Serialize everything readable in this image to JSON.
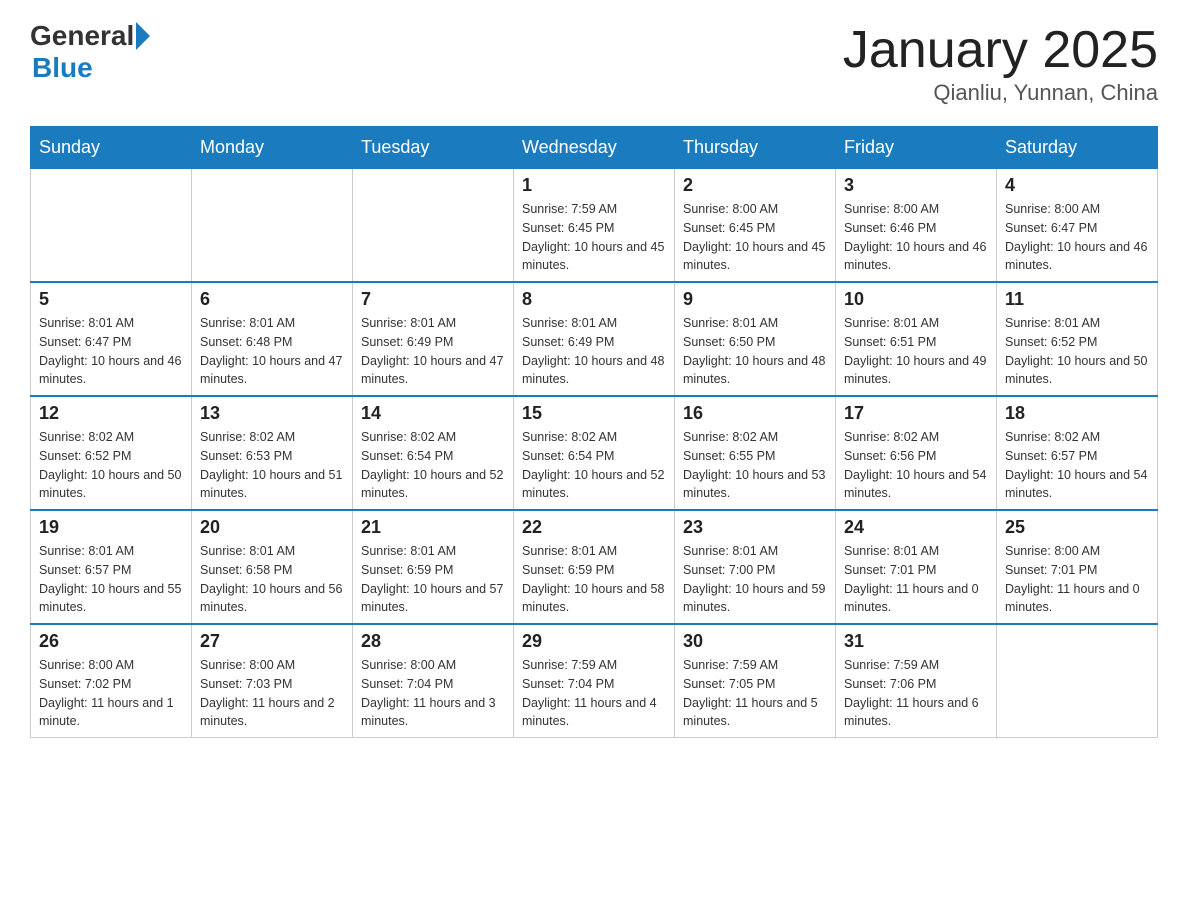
{
  "logo": {
    "text_general": "General",
    "text_blue": "Blue"
  },
  "title": "January 2025",
  "subtitle": "Qianliu, Yunnan, China",
  "days_of_week": [
    "Sunday",
    "Monday",
    "Tuesday",
    "Wednesday",
    "Thursday",
    "Friday",
    "Saturday"
  ],
  "weeks": [
    [
      {
        "day": "",
        "info": ""
      },
      {
        "day": "",
        "info": ""
      },
      {
        "day": "",
        "info": ""
      },
      {
        "day": "1",
        "info": "Sunrise: 7:59 AM\nSunset: 6:45 PM\nDaylight: 10 hours and 45 minutes."
      },
      {
        "day": "2",
        "info": "Sunrise: 8:00 AM\nSunset: 6:45 PM\nDaylight: 10 hours and 45 minutes."
      },
      {
        "day": "3",
        "info": "Sunrise: 8:00 AM\nSunset: 6:46 PM\nDaylight: 10 hours and 46 minutes."
      },
      {
        "day": "4",
        "info": "Sunrise: 8:00 AM\nSunset: 6:47 PM\nDaylight: 10 hours and 46 minutes."
      }
    ],
    [
      {
        "day": "5",
        "info": "Sunrise: 8:01 AM\nSunset: 6:47 PM\nDaylight: 10 hours and 46 minutes."
      },
      {
        "day": "6",
        "info": "Sunrise: 8:01 AM\nSunset: 6:48 PM\nDaylight: 10 hours and 47 minutes."
      },
      {
        "day": "7",
        "info": "Sunrise: 8:01 AM\nSunset: 6:49 PM\nDaylight: 10 hours and 47 minutes."
      },
      {
        "day": "8",
        "info": "Sunrise: 8:01 AM\nSunset: 6:49 PM\nDaylight: 10 hours and 48 minutes."
      },
      {
        "day": "9",
        "info": "Sunrise: 8:01 AM\nSunset: 6:50 PM\nDaylight: 10 hours and 48 minutes."
      },
      {
        "day": "10",
        "info": "Sunrise: 8:01 AM\nSunset: 6:51 PM\nDaylight: 10 hours and 49 minutes."
      },
      {
        "day": "11",
        "info": "Sunrise: 8:01 AM\nSunset: 6:52 PM\nDaylight: 10 hours and 50 minutes."
      }
    ],
    [
      {
        "day": "12",
        "info": "Sunrise: 8:02 AM\nSunset: 6:52 PM\nDaylight: 10 hours and 50 minutes."
      },
      {
        "day": "13",
        "info": "Sunrise: 8:02 AM\nSunset: 6:53 PM\nDaylight: 10 hours and 51 minutes."
      },
      {
        "day": "14",
        "info": "Sunrise: 8:02 AM\nSunset: 6:54 PM\nDaylight: 10 hours and 52 minutes."
      },
      {
        "day": "15",
        "info": "Sunrise: 8:02 AM\nSunset: 6:54 PM\nDaylight: 10 hours and 52 minutes."
      },
      {
        "day": "16",
        "info": "Sunrise: 8:02 AM\nSunset: 6:55 PM\nDaylight: 10 hours and 53 minutes."
      },
      {
        "day": "17",
        "info": "Sunrise: 8:02 AM\nSunset: 6:56 PM\nDaylight: 10 hours and 54 minutes."
      },
      {
        "day": "18",
        "info": "Sunrise: 8:02 AM\nSunset: 6:57 PM\nDaylight: 10 hours and 54 minutes."
      }
    ],
    [
      {
        "day": "19",
        "info": "Sunrise: 8:01 AM\nSunset: 6:57 PM\nDaylight: 10 hours and 55 minutes."
      },
      {
        "day": "20",
        "info": "Sunrise: 8:01 AM\nSunset: 6:58 PM\nDaylight: 10 hours and 56 minutes."
      },
      {
        "day": "21",
        "info": "Sunrise: 8:01 AM\nSunset: 6:59 PM\nDaylight: 10 hours and 57 minutes."
      },
      {
        "day": "22",
        "info": "Sunrise: 8:01 AM\nSunset: 6:59 PM\nDaylight: 10 hours and 58 minutes."
      },
      {
        "day": "23",
        "info": "Sunrise: 8:01 AM\nSunset: 7:00 PM\nDaylight: 10 hours and 59 minutes."
      },
      {
        "day": "24",
        "info": "Sunrise: 8:01 AM\nSunset: 7:01 PM\nDaylight: 11 hours and 0 minutes."
      },
      {
        "day": "25",
        "info": "Sunrise: 8:00 AM\nSunset: 7:01 PM\nDaylight: 11 hours and 0 minutes."
      }
    ],
    [
      {
        "day": "26",
        "info": "Sunrise: 8:00 AM\nSunset: 7:02 PM\nDaylight: 11 hours and 1 minute."
      },
      {
        "day": "27",
        "info": "Sunrise: 8:00 AM\nSunset: 7:03 PM\nDaylight: 11 hours and 2 minutes."
      },
      {
        "day": "28",
        "info": "Sunrise: 8:00 AM\nSunset: 7:04 PM\nDaylight: 11 hours and 3 minutes."
      },
      {
        "day": "29",
        "info": "Sunrise: 7:59 AM\nSunset: 7:04 PM\nDaylight: 11 hours and 4 minutes."
      },
      {
        "day": "30",
        "info": "Sunrise: 7:59 AM\nSunset: 7:05 PM\nDaylight: 11 hours and 5 minutes."
      },
      {
        "day": "31",
        "info": "Sunrise: 7:59 AM\nSunset: 7:06 PM\nDaylight: 11 hours and 6 minutes."
      },
      {
        "day": "",
        "info": ""
      }
    ]
  ]
}
